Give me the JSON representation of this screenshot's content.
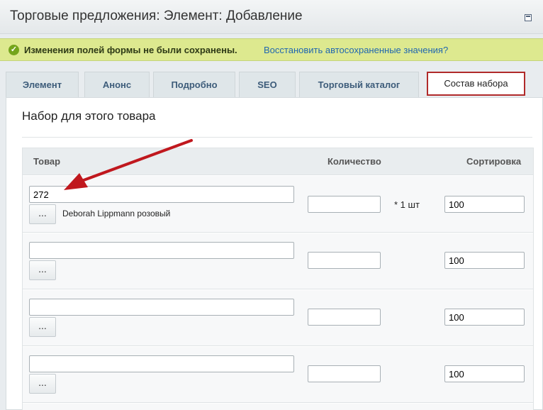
{
  "window": {
    "title": "Торговые предложения: Элемент: Добавление"
  },
  "notice": {
    "message": "Изменения полей формы не были сохранены.",
    "restore_link": "Восстановить автосохраненные значения?"
  },
  "tabs": [
    {
      "label": "Элемент"
    },
    {
      "label": "Анонс"
    },
    {
      "label": "Подробно"
    },
    {
      "label": "SEO"
    },
    {
      "label": "Торговый каталог"
    },
    {
      "label": "Состав набора"
    }
  ],
  "active_tab": "Состав набора",
  "section": {
    "title": "Набор для этого товара"
  },
  "table": {
    "headers": {
      "product": "Товар",
      "quantity": "Количество",
      "sort": "Сортировка"
    },
    "browse_label": "...",
    "rows": [
      {
        "product_id": "272",
        "product_name": "Deborah Lippmann розовый",
        "quantity": "",
        "unit": "* 1 шт",
        "sort": "100"
      },
      {
        "product_id": "",
        "product_name": "",
        "quantity": "",
        "unit": "",
        "sort": "100"
      },
      {
        "product_id": "",
        "product_name": "",
        "quantity": "",
        "unit": "",
        "sort": "100"
      },
      {
        "product_id": "",
        "product_name": "",
        "quantity": "",
        "unit": "",
        "sort": "100"
      }
    ]
  },
  "colors": {
    "accent_red": "#b02a2a",
    "notice_bg": "#dde98f",
    "link": "#2067b0"
  }
}
